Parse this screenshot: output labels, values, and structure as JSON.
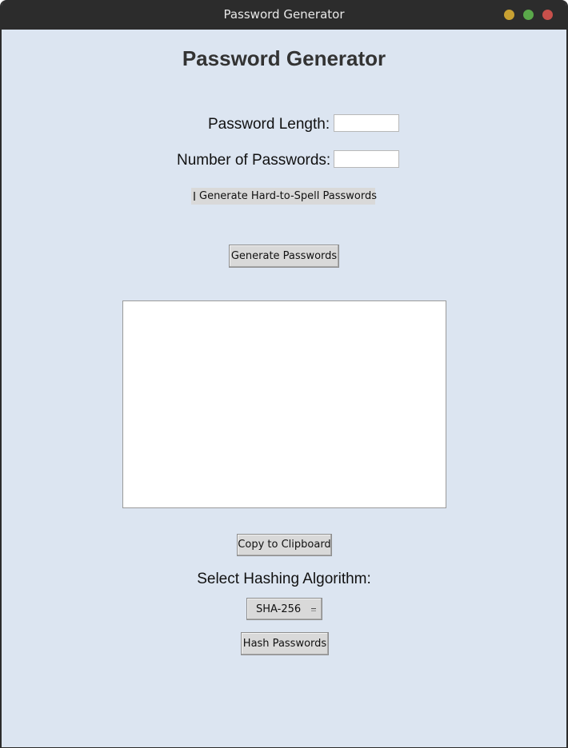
{
  "window": {
    "title": "Password Generator"
  },
  "app": {
    "heading": "Password Generator"
  },
  "form": {
    "length_label": "Password Length:",
    "length_value": "",
    "count_label": "Number of Passwords:",
    "count_value": "",
    "hard_to_spell_label": "Generate Hard-to-Spell Passwords",
    "hard_to_spell_checked": false
  },
  "actions": {
    "generate_label": "Generate Passwords",
    "copy_label": "Copy to Clipboard",
    "hash_label": "Hash Passwords"
  },
  "output": {
    "text": ""
  },
  "hashing": {
    "label": "Select Hashing Algorithm:",
    "selected": "SHA-256"
  },
  "colors": {
    "background": "#dce5f1",
    "titlebar": "#2c2c2c",
    "button": "#d9d9d9"
  }
}
